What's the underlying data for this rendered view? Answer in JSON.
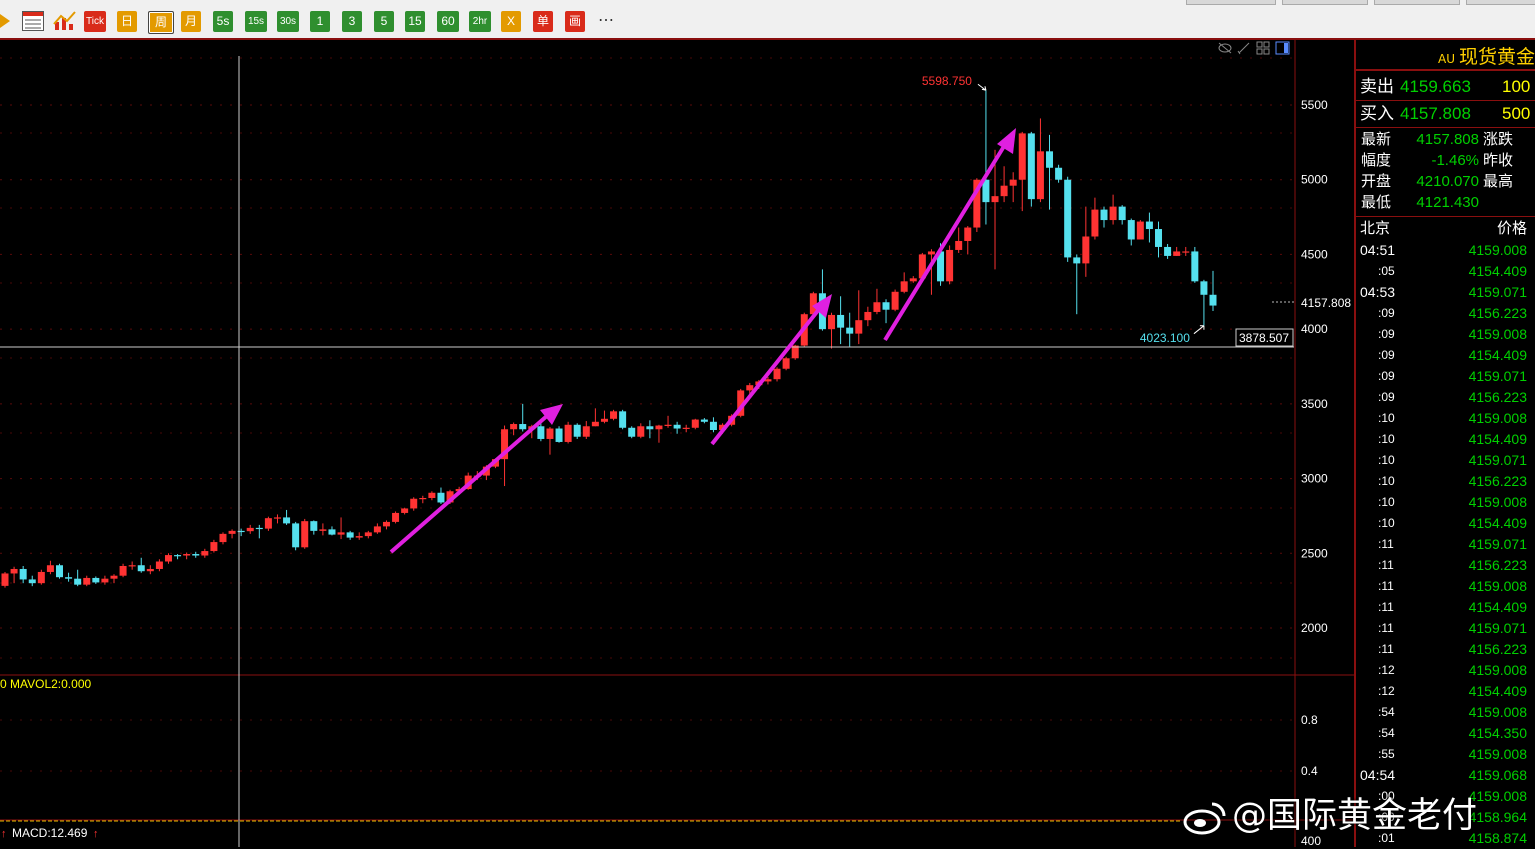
{
  "toolbar": {
    "buttons": [
      {
        "id": "tick",
        "label": "Tick",
        "color": "#d92b1a"
      },
      {
        "id": "day",
        "label": "日",
        "color": "#e39a00"
      },
      {
        "id": "week",
        "label": "周",
        "color": "#e39a00",
        "selected": true
      },
      {
        "id": "month",
        "label": "月",
        "color": "#e39a00"
      },
      {
        "id": "s5",
        "label": "5s",
        "color": "#2f8f2f"
      },
      {
        "id": "s15",
        "label": "15s",
        "color": "#2f8f2f"
      },
      {
        "id": "s30",
        "label": "30s",
        "color": "#2f8f2f"
      },
      {
        "id": "m1",
        "label": "1",
        "color": "#2f8f2f"
      },
      {
        "id": "m3",
        "label": "3",
        "color": "#2f8f2f"
      },
      {
        "id": "m5",
        "label": "5",
        "color": "#2f8f2f"
      },
      {
        "id": "m15",
        "label": "15",
        "color": "#2f8f2f"
      },
      {
        "id": "m60",
        "label": "60",
        "color": "#2f8f2f"
      },
      {
        "id": "h2",
        "label": "2hr",
        "color": "#2f8f2f"
      },
      {
        "id": "x",
        "label": "X",
        "color": "#e39a00"
      },
      {
        "id": "single",
        "label": "单",
        "color": "#d92b1a"
      },
      {
        "id": "draw",
        "label": "画",
        "color": "#d92b1a"
      }
    ],
    "more": "⋯"
  },
  "chart_data": {
    "type": "candlestick",
    "period": "weekly",
    "price_axis": {
      "ticks": [
        2000,
        2500,
        3000,
        3500,
        4000,
        4500,
        5000,
        5500
      ]
    },
    "volume_axis": {
      "ticks": [
        0.8,
        0.4
      ]
    },
    "macd_axis": {
      "ticks": [
        400
      ]
    },
    "indicators": {
      "volume": "0 MAVOL2:0.000",
      "macd": "MACD:12.469"
    },
    "annotations": {
      "high_label": "5598.750",
      "low_label": "4023.100",
      "last_price_tag": "4157.808",
      "crosshair_price": "3878.507"
    },
    "colors": {
      "up": "#ff3333",
      "down": "#55e0ee"
    },
    "candles": [
      [
        2282,
        2365,
        2270,
        2375
      ],
      [
        2365,
        2395,
        2300,
        2410
      ],
      [
        2395,
        2325,
        2300,
        2415
      ],
      [
        2325,
        2300,
        2280,
        2350
      ],
      [
        2300,
        2375,
        2290,
        2390
      ],
      [
        2375,
        2420,
        2360,
        2450
      ],
      [
        2420,
        2340,
        2330,
        2430
      ],
      [
        2340,
        2330,
        2310,
        2370
      ],
      [
        2330,
        2290,
        2280,
        2390
      ],
      [
        2290,
        2335,
        2280,
        2350
      ],
      [
        2335,
        2305,
        2295,
        2345
      ],
      [
        2305,
        2330,
        2290,
        2350
      ],
      [
        2330,
        2350,
        2300,
        2360
      ],
      [
        2350,
        2415,
        2340,
        2430
      ],
      [
        2415,
        2420,
        2390,
        2445
      ],
      [
        2420,
        2380,
        2370,
        2470
      ],
      [
        2380,
        2395,
        2360,
        2420
      ],
      [
        2395,
        2445,
        2380,
        2460
      ],
      [
        2445,
        2488,
        2430,
        2500
      ],
      [
        2488,
        2485,
        2460,
        2495
      ],
      [
        2485,
        2495,
        2460,
        2505
      ],
      [
        2495,
        2485,
        2470,
        2510
      ],
      [
        2485,
        2515,
        2470,
        2530
      ],
      [
        2515,
        2575,
        2505,
        2590
      ],
      [
        2575,
        2630,
        2560,
        2640
      ],
      [
        2630,
        2650,
        2600,
        2660
      ],
      [
        2650,
        2648,
        2615,
        2665
      ],
      [
        2648,
        2670,
        2630,
        2690
      ],
      [
        2670,
        2665,
        2600,
        2690
      ],
      [
        2665,
        2735,
        2650,
        2745
      ],
      [
        2735,
        2740,
        2700,
        2760
      ],
      [
        2740,
        2700,
        2690,
        2790
      ],
      [
        2700,
        2540,
        2520,
        2710
      ],
      [
        2540,
        2715,
        2530,
        2730
      ],
      [
        2715,
        2650,
        2625,
        2720
      ],
      [
        2650,
        2660,
        2620,
        2700
      ],
      [
        2660,
        2625,
        2620,
        2680
      ],
      [
        2625,
        2640,
        2595,
        2740
      ],
      [
        2640,
        2605,
        2590,
        2650
      ],
      [
        2605,
        2615,
        2590,
        2640
      ],
      [
        2615,
        2640,
        2600,
        2650
      ],
      [
        2640,
        2680,
        2630,
        2700
      ],
      [
        2680,
        2710,
        2660,
        2720
      ],
      [
        2710,
        2770,
        2700,
        2780
      ],
      [
        2770,
        2800,
        2760,
        2805
      ],
      [
        2800,
        2865,
        2785,
        2875
      ],
      [
        2865,
        2870,
        2835,
        2885
      ],
      [
        2870,
        2905,
        2855,
        2915
      ],
      [
        2905,
        2840,
        2830,
        2940
      ],
      [
        2840,
        2915,
        2830,
        2925
      ],
      [
        2915,
        2930,
        2890,
        2945
      ],
      [
        2930,
        3020,
        2925,
        3040
      ],
      [
        3020,
        3020,
        2990,
        3050
      ],
      [
        3020,
        3080,
        2990,
        3090
      ],
      [
        3080,
        3130,
        3070,
        3135
      ],
      [
        3130,
        3330,
        2950,
        3355
      ],
      [
        3330,
        3365,
        3290,
        3375
      ],
      [
        3365,
        3330,
        3315,
        3500
      ],
      [
        3330,
        3350,
        3270,
        3360
      ],
      [
        3350,
        3265,
        3250,
        3370
      ],
      [
        3265,
        3335,
        3160,
        3345
      ],
      [
        3335,
        3245,
        3240,
        3350
      ],
      [
        3245,
        3360,
        3235,
        3380
      ],
      [
        3360,
        3280,
        3265,
        3370
      ],
      [
        3280,
        3350,
        3265,
        3385
      ],
      [
        3350,
        3380,
        3350,
        3470
      ],
      [
        3380,
        3400,
        3370,
        3455
      ],
      [
        3400,
        3450,
        3390,
        3460
      ],
      [
        3450,
        3340,
        3330,
        3460
      ],
      [
        3340,
        3280,
        3270,
        3350
      ],
      [
        3280,
        3350,
        3270,
        3370
      ],
      [
        3350,
        3330,
        3270,
        3390
      ],
      [
        3330,
        3355,
        3240,
        3360
      ],
      [
        3355,
        3360,
        3340,
        3420
      ],
      [
        3360,
        3335,
        3300,
        3380
      ],
      [
        3335,
        3340,
        3310,
        3360
      ],
      [
        3340,
        3395,
        3330,
        3400
      ],
      [
        3395,
        3380,
        3370,
        3405
      ],
      [
        3380,
        3325,
        3310,
        3410
      ],
      [
        3325,
        3360,
        3300,
        3370
      ],
      [
        3360,
        3420,
        3350,
        3430
      ],
      [
        3420,
        3590,
        3410,
        3600
      ],
      [
        3590,
        3625,
        3550,
        3640
      ],
      [
        3625,
        3650,
        3600,
        3660
      ],
      [
        3650,
        3665,
        3630,
        3680
      ],
      [
        3665,
        3735,
        3650,
        3745
      ],
      [
        3735,
        3805,
        3725,
        3815
      ],
      [
        3805,
        3890,
        3795,
        3895
      ],
      [
        3890,
        4100,
        3880,
        4110
      ],
      [
        4100,
        4240,
        4090,
        4250
      ],
      [
        4240,
        4000,
        3990,
        4400
      ],
      [
        4000,
        4095,
        3870,
        4110
      ],
      [
        4095,
        4010,
        3900,
        4220
      ],
      [
        4010,
        3970,
        3880,
        4110
      ],
      [
        3970,
        4060,
        3900,
        4260
      ],
      [
        4060,
        4115,
        4020,
        4150
      ],
      [
        4115,
        4180,
        4100,
        4270
      ],
      [
        4180,
        4130,
        4040,
        4200
      ],
      [
        4130,
        4250,
        4120,
        4265
      ],
      [
        4250,
        4320,
        4240,
        4380
      ],
      [
        4320,
        4340,
        4310,
        4355
      ],
      [
        4340,
        4500,
        4330,
        4510
      ],
      [
        4500,
        4520,
        4230,
        4535
      ],
      [
        4520,
        4320,
        4290,
        4575
      ],
      [
        4320,
        4530,
        4300,
        4560
      ],
      [
        4530,
        4590,
        4510,
        4680
      ],
      [
        4590,
        4680,
        4500,
        4690
      ],
      [
        4680,
        5000,
        4650,
        5010
      ],
      [
        5000,
        4850,
        4700,
        5598.75
      ],
      [
        4850,
        4890,
        4400,
        5200
      ],
      [
        4890,
        4960,
        4850,
        5090
      ],
      [
        4960,
        5000,
        4850,
        5050
      ],
      [
        5000,
        5310,
        4790,
        5320
      ],
      [
        5310,
        4870,
        4820,
        5320
      ],
      [
        4870,
        5190,
        4850,
        5410
      ],
      [
        5190,
        5080,
        4800,
        5300
      ],
      [
        5080,
        5000,
        4980,
        5100
      ],
      [
        5000,
        4480,
        4450,
        5020
      ],
      [
        4480,
        4440,
        4100,
        4500
      ],
      [
        4440,
        4620,
        4350,
        4820
      ],
      [
        4620,
        4800,
        4600,
        4880
      ],
      [
        4800,
        4730,
        4680,
        4820
      ],
      [
        4730,
        4820,
        4700,
        4900
      ],
      [
        4820,
        4730,
        4700,
        4830
      ],
      [
        4730,
        4600,
        4560,
        4740
      ],
      [
        4600,
        4720,
        4600,
        4730
      ],
      [
        4720,
        4670,
        4580,
        4780
      ],
      [
        4670,
        4550,
        4480,
        4720
      ],
      [
        4550,
        4490,
        4470,
        4570
      ],
      [
        4490,
        4520,
        4490,
        4550
      ],
      [
        4520,
        4520,
        4490,
        4550
      ],
      [
        4520,
        4320,
        4310,
        4550
      ],
      [
        4320,
        4230,
        4023.1,
        4330
      ],
      [
        4230,
        4157.808,
        4121.43,
        4390
      ]
    ]
  },
  "panel": {
    "title_prefix": "AU",
    "title": "现货黄金",
    "sell": {
      "label": "卖出",
      "price": "4159.663",
      "qty": "100"
    },
    "buy": {
      "label": "买入",
      "price": "4157.808",
      "qty": "500"
    },
    "stats": [
      {
        "label": "最新",
        "value": "4157.808",
        "label2": "涨跌"
      },
      {
        "label": "幅度",
        "value": "-1.46%",
        "label2": "昨收"
      },
      {
        "label": "开盘",
        "value": "4210.070",
        "label2": "最高"
      },
      {
        "label": "最低",
        "value": "4121.430",
        "label2": ""
      }
    ],
    "ticks_header": {
      "time": "北京",
      "price": "价格"
    },
    "ticks": [
      {
        "time": "04:51",
        "price": "4159.008"
      },
      {
        "time": ":05",
        "price": "4154.409"
      },
      {
        "time": "04:53",
        "price": "4159.071"
      },
      {
        "time": ":09",
        "price": "4156.223"
      },
      {
        "time": ":09",
        "price": "4159.008"
      },
      {
        "time": ":09",
        "price": "4154.409"
      },
      {
        "time": ":09",
        "price": "4159.071"
      },
      {
        "time": ":09",
        "price": "4156.223"
      },
      {
        "time": ":10",
        "price": "4159.008"
      },
      {
        "time": ":10",
        "price": "4154.409"
      },
      {
        "time": ":10",
        "price": "4159.071"
      },
      {
        "time": ":10",
        "price": "4156.223"
      },
      {
        "time": ":10",
        "price": "4159.008"
      },
      {
        "time": ":10",
        "price": "4154.409"
      },
      {
        "time": ":11",
        "price": "4159.071"
      },
      {
        "time": ":11",
        "price": "4156.223"
      },
      {
        "time": ":11",
        "price": "4159.008"
      },
      {
        "time": ":11",
        "price": "4154.409"
      },
      {
        "time": ":11",
        "price": "4159.071"
      },
      {
        "time": ":11",
        "price": "4156.223"
      },
      {
        "time": ":12",
        "price": "4159.008"
      },
      {
        "time": ":12",
        "price": "4154.409"
      },
      {
        "time": ":54",
        "price": "4159.008"
      },
      {
        "time": ":54",
        "price": "4154.350"
      },
      {
        "time": ":55",
        "price": "4159.008"
      },
      {
        "time": "04:54",
        "price": "4159.068"
      },
      {
        "time": ":00",
        "price": "4159.008"
      },
      {
        "time": ":00",
        "price": "4158.964"
      },
      {
        "time": ":01",
        "price": "4158.874"
      }
    ]
  },
  "watermark": "@国际黄金老付"
}
